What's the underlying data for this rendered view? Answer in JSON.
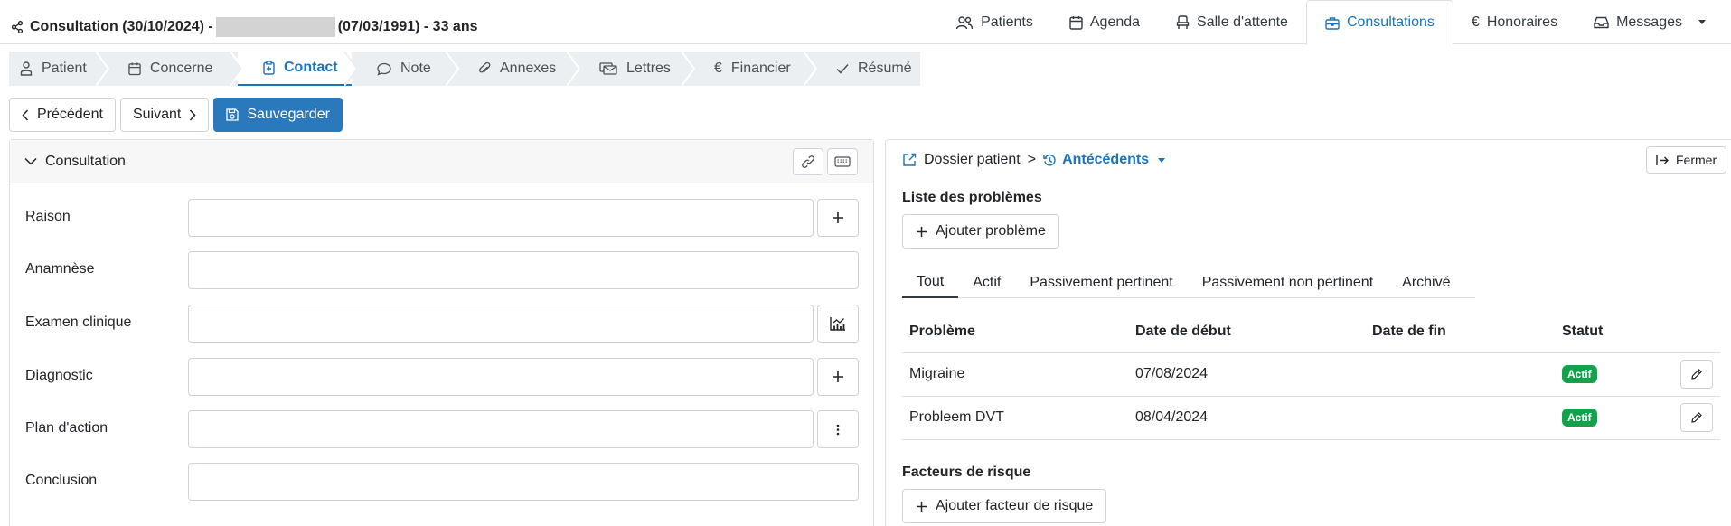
{
  "header": {
    "title_prefix": "Consultation (30/10/2024) -",
    "title_suffix": "(07/03/1991) - 33 ans"
  },
  "topnav": [
    {
      "label": "Patients",
      "icon": "users-icon"
    },
    {
      "label": "Agenda",
      "icon": "calendar-icon"
    },
    {
      "label": "Salle d'attente",
      "icon": "chair-icon"
    },
    {
      "label": "Consultations",
      "icon": "briefcase-icon",
      "active": true
    },
    {
      "label": "Honoraires",
      "icon": "euro-icon"
    },
    {
      "label": "Messages",
      "icon": "inbox-icon"
    }
  ],
  "steps": [
    {
      "label": "Patient",
      "icon": "person-icon"
    },
    {
      "label": "Concerne",
      "icon": "calendar-icon"
    },
    {
      "label": "Contact",
      "icon": "clipboard-icon",
      "active": true
    },
    {
      "label": "Note",
      "icon": "chat-icon"
    },
    {
      "label": "Annexes",
      "icon": "paperclip-icon"
    },
    {
      "label": "Lettres",
      "icon": "letters-icon"
    },
    {
      "label": "Financier",
      "icon": "euro-icon"
    },
    {
      "label": "Résumé",
      "icon": "check-icon"
    }
  ],
  "actions": {
    "previous": "Précédent",
    "next": "Suivant",
    "save": "Sauvegarder"
  },
  "consultation": {
    "title": "Consultation",
    "fields": [
      {
        "label": "Raison",
        "value": "",
        "side": "plus-icon"
      },
      {
        "label": "Anamnèse",
        "value": ""
      },
      {
        "label": "Examen clinique",
        "value": "",
        "side": "chart-icon"
      },
      {
        "label": "Diagnostic",
        "value": "",
        "side": "plus-icon"
      },
      {
        "label": "Plan d'action",
        "value": "",
        "side": "kebab-icon"
      },
      {
        "label": "Conclusion",
        "value": ""
      }
    ]
  },
  "dossier": {
    "crumb": "Dossier patient",
    "separator": ">",
    "section": "Antécédents",
    "close": "Fermer",
    "problems_title": "Liste des problèmes",
    "add_problem": "Ajouter problème",
    "filters": [
      "Tout",
      "Actif",
      "Passivement pertinent",
      "Passivement non pertinent",
      "Archivé"
    ],
    "table": {
      "headers": [
        "Problème",
        "Date de début",
        "Date de fin",
        "Statut"
      ],
      "rows": [
        {
          "problem": "Migraine",
          "start": "07/08/2024",
          "end": "",
          "status": "Actif"
        },
        {
          "problem": "Probleem DVT",
          "start": "08/04/2024",
          "end": "",
          "status": "Actif"
        }
      ]
    },
    "risk_title": "Facteurs de risque",
    "add_risk": "Ajouter facteur de risque"
  },
  "colors": {
    "accent": "#1b75bb",
    "primary_button": "#2a79bc",
    "status_active": "#13a24b"
  }
}
